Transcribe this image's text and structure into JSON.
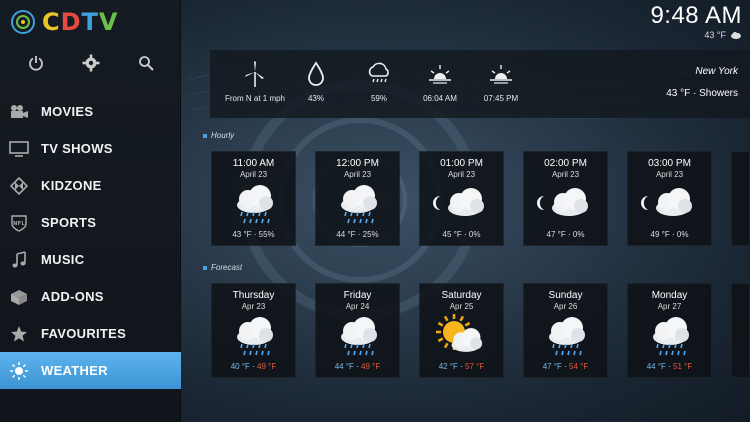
{
  "logo": {
    "letters": [
      "C",
      "D",
      "T",
      "V"
    ]
  },
  "top_icons": [
    "power-icon",
    "gear-icon",
    "search-icon"
  ],
  "menu": [
    {
      "label": "MOVIES",
      "icon": "movie-camera-icon"
    },
    {
      "label": "TV SHOWS",
      "icon": "tv-icon"
    },
    {
      "label": "KIDZONE",
      "icon": "kodi-icon"
    },
    {
      "label": "SPORTS",
      "icon": "nfl-shield-icon"
    },
    {
      "label": "MUSIC",
      "icon": "music-note-icon"
    },
    {
      "label": "ADD-ONS",
      "icon": "box-icon"
    },
    {
      "label": "FAVOURITES",
      "icon": "star-icon"
    },
    {
      "label": "WEATHER",
      "icon": "sun-icon",
      "active": true
    }
  ],
  "clock": {
    "time": "9:48 AM",
    "mini_temp": "43 °F",
    "mini_icon": "cloud-icon"
  },
  "current": {
    "wind": "From N at 1 mph",
    "humidity": "43%",
    "precip": "59%",
    "sunrise": "06:04 AM",
    "sunset": "07:45 PM",
    "location": "New York",
    "condition": "43 °F · Showers"
  },
  "hourly_label": "Hourly",
  "forecast_label": "Forecast",
  "hourly": [
    {
      "time": "11:00 AM",
      "date": "April 23",
      "icon": "rain-cloud",
      "temp": "43 °F",
      "pct": "55%"
    },
    {
      "time": "12:00 PM",
      "date": "April 23",
      "icon": "rain-cloud",
      "temp": "44 °F",
      "pct": "25%"
    },
    {
      "time": "01:00 PM",
      "date": "April 23",
      "icon": "moon-cloud",
      "temp": "45 °F",
      "pct": "0%"
    },
    {
      "time": "02:00 PM",
      "date": "April 23",
      "icon": "moon-cloud",
      "temp": "47 °F",
      "pct": "0%"
    },
    {
      "time": "03:00 PM",
      "date": "April 23",
      "icon": "moon-cloud",
      "temp": "49 °F",
      "pct": "0%"
    }
  ],
  "forecast": [
    {
      "day": "Thursday",
      "date": "Apr 23",
      "icon": "rain-cloud",
      "lo": "40 °F",
      "hi": "49 °F"
    },
    {
      "day": "Friday",
      "date": "Apr 24",
      "icon": "rain-cloud",
      "lo": "44 °F",
      "hi": "49 °F"
    },
    {
      "day": "Saturday",
      "date": "Apr 25",
      "icon": "sun-cloud",
      "lo": "42 °F",
      "hi": "57 °F"
    },
    {
      "day": "Sunday",
      "date": "Apr 26",
      "icon": "rain-cloud",
      "lo": "47 °F",
      "hi": "54 °F"
    },
    {
      "day": "Monday",
      "date": "Apr 27",
      "icon": "rain-cloud",
      "lo": "44 °F",
      "hi": "51 °F"
    }
  ],
  "colors": {
    "accent": "#4aa3e0",
    "active_menu": "#4ea6e4",
    "hi_temp": "#e35b3b",
    "lo_temp": "#7ab8e8"
  }
}
